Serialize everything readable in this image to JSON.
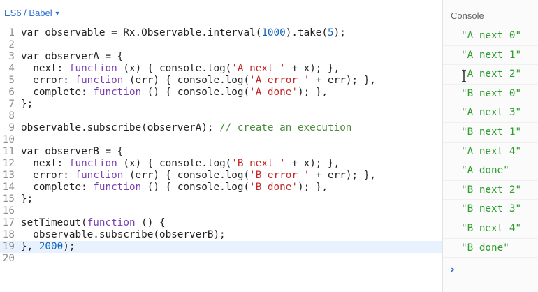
{
  "editor": {
    "language_label": "ES6 / Babel",
    "lines": [
      {
        "n": "1",
        "tokens": [
          [
            "",
            "var observable = Rx.Observable.interval("
          ],
          [
            "num",
            "1000"
          ],
          [
            "",
            ").take("
          ],
          [
            "num",
            "5"
          ],
          [
            "",
            ");"
          ]
        ]
      },
      {
        "n": "2",
        "tokens": []
      },
      {
        "n": "3",
        "tokens": [
          [
            "",
            "var observerA = {"
          ]
        ]
      },
      {
        "n": "4",
        "tokens": [
          [
            "",
            "  next: "
          ],
          [
            "kw",
            "function"
          ],
          [
            "",
            " (x) { console.log("
          ],
          [
            "str",
            "'A next '"
          ],
          [
            "",
            " + x); },"
          ]
        ]
      },
      {
        "n": "5",
        "tokens": [
          [
            "",
            "  error: "
          ],
          [
            "kw",
            "function"
          ],
          [
            "",
            " (err) { console.log("
          ],
          [
            "str",
            "'A error '"
          ],
          [
            "",
            " + err); },"
          ]
        ]
      },
      {
        "n": "6",
        "tokens": [
          [
            "",
            "  complete: "
          ],
          [
            "kw",
            "function"
          ],
          [
            "",
            " () { console.log("
          ],
          [
            "str",
            "'A done'"
          ],
          [
            "",
            "); },"
          ]
        ]
      },
      {
        "n": "7",
        "tokens": [
          [
            "",
            "};"
          ]
        ]
      },
      {
        "n": "8",
        "tokens": []
      },
      {
        "n": "9",
        "tokens": [
          [
            "",
            "observable.subscribe(observerA); "
          ],
          [
            "cm",
            "// create an execution"
          ]
        ]
      },
      {
        "n": "10",
        "tokens": []
      },
      {
        "n": "11",
        "tokens": [
          [
            "",
            "var observerB = {"
          ]
        ]
      },
      {
        "n": "12",
        "tokens": [
          [
            "",
            "  next: "
          ],
          [
            "kw",
            "function"
          ],
          [
            "",
            " (x) { console.log("
          ],
          [
            "str",
            "'B next '"
          ],
          [
            "",
            " + x); },"
          ]
        ]
      },
      {
        "n": "13",
        "tokens": [
          [
            "",
            "  error: "
          ],
          [
            "kw",
            "function"
          ],
          [
            "",
            " (err) { console.log("
          ],
          [
            "str",
            "'B error '"
          ],
          [
            "",
            " + err); },"
          ]
        ]
      },
      {
        "n": "14",
        "tokens": [
          [
            "",
            "  complete: "
          ],
          [
            "kw",
            "function"
          ],
          [
            "",
            " () { console.log("
          ],
          [
            "str",
            "'B done'"
          ],
          [
            "",
            "); },"
          ]
        ]
      },
      {
        "n": "15",
        "tokens": [
          [
            "",
            "};"
          ]
        ]
      },
      {
        "n": "16",
        "tokens": []
      },
      {
        "n": "17",
        "tokens": [
          [
            "",
            "setTimeout("
          ],
          [
            "kw",
            "function"
          ],
          [
            "",
            " () {"
          ]
        ]
      },
      {
        "n": "18",
        "tokens": [
          [
            "",
            "  observable.subscribe(observerB);"
          ]
        ]
      },
      {
        "n": "19",
        "active": true,
        "tokens": [
          [
            "",
            "}, "
          ],
          [
            "num",
            "2000"
          ],
          [
            "",
            ");"
          ]
        ]
      },
      {
        "n": "20",
        "tokens": []
      }
    ]
  },
  "console": {
    "title": "Console",
    "lines": [
      "\"A next 0\"",
      "\"A next 1\"",
      "\"A next 2\"",
      "\"B next 0\"",
      "\"A next 3\"",
      "\"B next 1\"",
      "\"A next 4\"",
      "\"A done\"",
      "\"B next 2\"",
      "\"B next 3\"",
      "\"B next 4\"",
      "\"B done\""
    ],
    "prompt": "›"
  },
  "colors": {
    "keyword": "#7a3fb3",
    "string": "#c62828",
    "number": "#1565c0",
    "comment": "#4a8b3c",
    "console_output": "#2e9e2e",
    "accent": "#2a6fd3"
  }
}
